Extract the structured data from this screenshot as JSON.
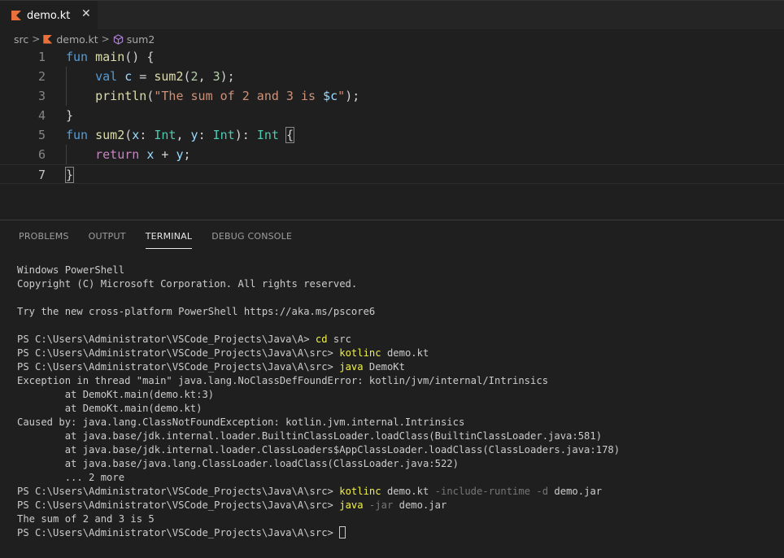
{
  "tabs": [
    {
      "label": "demo.kt",
      "icon": "kotlin-file-icon",
      "close_icon": "close-icon"
    }
  ],
  "breadcrumb": [
    "src",
    "demo.kt",
    "sum2"
  ],
  "editor": {
    "line_numbers": [
      "1",
      "2",
      "3",
      "4",
      "5",
      "6",
      "7"
    ],
    "active_line": 7,
    "lines": [
      "fun main() {",
      "    val c = sum2(2, 3);",
      "    println(\"The sum of 2 and 3 is $c\");",
      "}",
      "fun sum2(x: Int, y: Int): Int {",
      "    return x + y;",
      "}"
    ]
  },
  "panel": {
    "tabs": [
      "PROBLEMS",
      "OUTPUT",
      "TERMINAL",
      "DEBUG CONSOLE"
    ],
    "active_tab": "TERMINAL"
  },
  "terminal": {
    "header1": "Windows PowerShell",
    "header2": "Copyright (C) Microsoft Corporation. All rights reserved.",
    "header3": "Try the new cross-platform PowerShell https://aka.ms/pscore6",
    "prompt_a": "PS C:\\Users\\Administrator\\VSCode_Projects\\Java\\A> ",
    "prompt_src": "PS C:\\Users\\Administrator\\VSCode_Projects\\Java\\A\\src> ",
    "cmd1": "cd",
    "cmd1_rest": " src",
    "cmd2": "kotlinc",
    "cmd2_rest": " demo.kt",
    "cmd3": "java",
    "cmd3_rest": " DemoKt",
    "err1": "Exception in thread \"main\" java.lang.NoClassDefFoundError: kotlin/jvm/internal/Intrinsics",
    "err2": "        at DemoKt.main(demo.kt:3)",
    "err3": "        at DemoKt.main(demo.kt)",
    "err4": "Caused by: java.lang.ClassNotFoundException: kotlin.jvm.internal.Intrinsics",
    "err5": "        at java.base/jdk.internal.loader.BuiltinClassLoader.loadClass(BuiltinClassLoader.java:581)",
    "err6": "        at java.base/jdk.internal.loader.ClassLoaders$AppClassLoader.loadClass(ClassLoaders.java:178)",
    "err7": "        at java.base/java.lang.ClassLoader.loadClass(ClassLoader.java:522)",
    "err8": "        ... 2 more",
    "cmd4": "kotlinc",
    "cmd4_a": " demo.kt ",
    "cmd4_flags": "-include-runtime -d",
    "cmd4_b": " demo.jar",
    "cmd5": "java",
    "cmd5_flag": " -jar",
    "cmd5_rest": " demo.jar",
    "output": "The sum of 2 and 3 is 5"
  }
}
